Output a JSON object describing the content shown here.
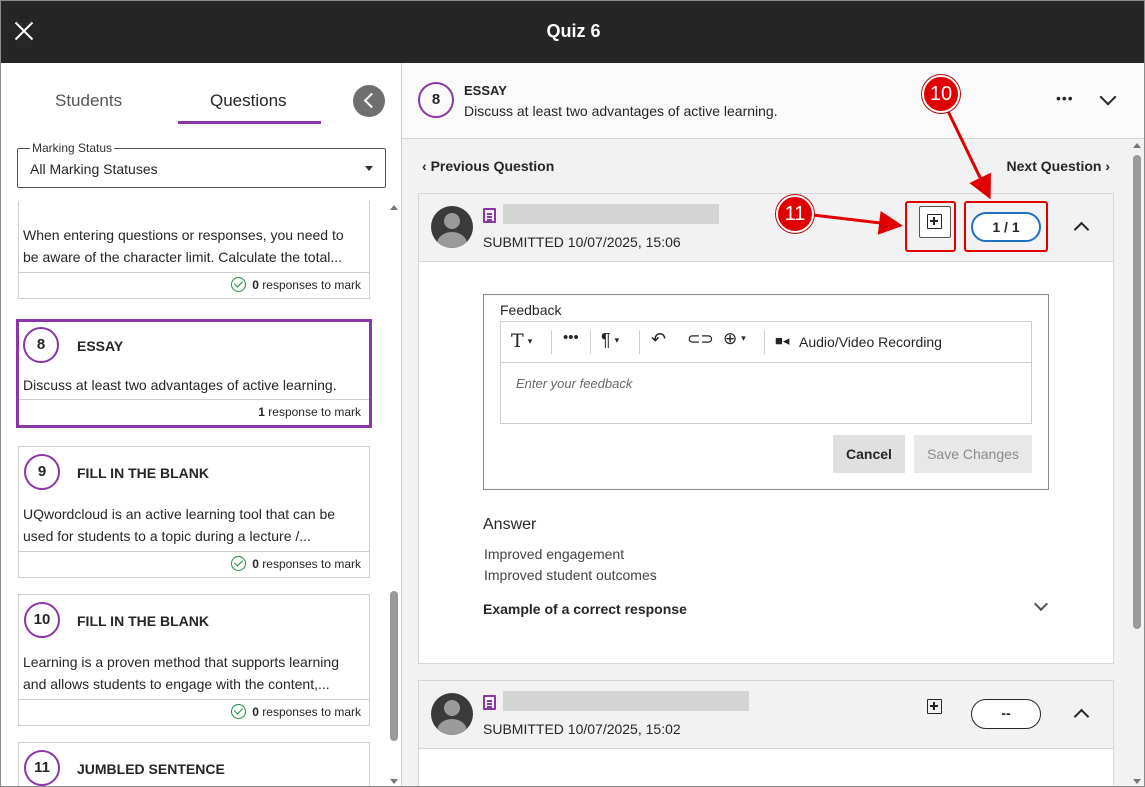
{
  "window": {
    "title": "Quiz 6"
  },
  "left": {
    "tabs": [
      {
        "label": "Students"
      },
      {
        "label": "Questions"
      }
    ],
    "filter": {
      "label": "Marking Status",
      "value": "All Marking Statuses"
    },
    "cards": [
      {
        "number": "",
        "type": "",
        "text": "When entering questions or responses, you need to be aware of the character limit. Calculate the total...",
        "count": "0",
        "suffix": "responses to mark"
      },
      {
        "number": "8",
        "type": "ESSAY",
        "text": "Discuss at least two advantages of active learning.",
        "count": "1",
        "suffix": "response to mark"
      },
      {
        "number": "9",
        "type": "FILL IN THE BLANK",
        "text": "UQwordcloud is an active learning tool that can be used for students to a topic during a lecture /...",
        "count": "0",
        "suffix": "responses to mark"
      },
      {
        "number": "10",
        "type": "FILL IN THE BLANK",
        "text": "Learning is a proven method that supports learning and allows students to engage with the content,...",
        "count": "0",
        "suffix": "responses to mark"
      },
      {
        "number": "11",
        "type": "JUMBLED SENTENCE",
        "text": "",
        "count": "",
        "suffix": ""
      }
    ]
  },
  "question": {
    "number": "8",
    "type": "ESSAY",
    "text": "Discuss at least two advantages of active learning.",
    "prev_label": "Previous Question",
    "next_label": "Next Question"
  },
  "submissions": [
    {
      "submitted": "SUBMITTED 10/07/2025, 15:06",
      "score": "1 / 1"
    },
    {
      "submitted": "SUBMITTED 10/07/2025, 15:02",
      "score": "--"
    }
  ],
  "feedback": {
    "label": "Feedback",
    "placeholder": "Enter your feedback",
    "toolbar": {
      "audio_video": "Audio/Video Recording"
    },
    "cancel": "Cancel",
    "save": "Save Changes"
  },
  "answer": {
    "heading": "Answer",
    "lines": [
      "Improved engagement",
      "Improved student outcomes"
    ],
    "example": "Example of a correct response"
  },
  "annotations": {
    "callout_10": "10",
    "callout_11": "11"
  },
  "colors": {
    "accent": "#8a35a8",
    "callout": "#e00000",
    "score_border": "#1f6fc4",
    "topbar": "#262626"
  },
  "icons": [
    "close-icon",
    "back-arrow-icon",
    "chevron-down-icon",
    "more-icon",
    "document-icon",
    "add-feedback-icon",
    "chevron-up-icon",
    "check-circle-icon",
    "text-format-icon",
    "paragraph-icon",
    "undo-icon",
    "link-icon",
    "insert-icon",
    "video-camera-icon"
  ]
}
